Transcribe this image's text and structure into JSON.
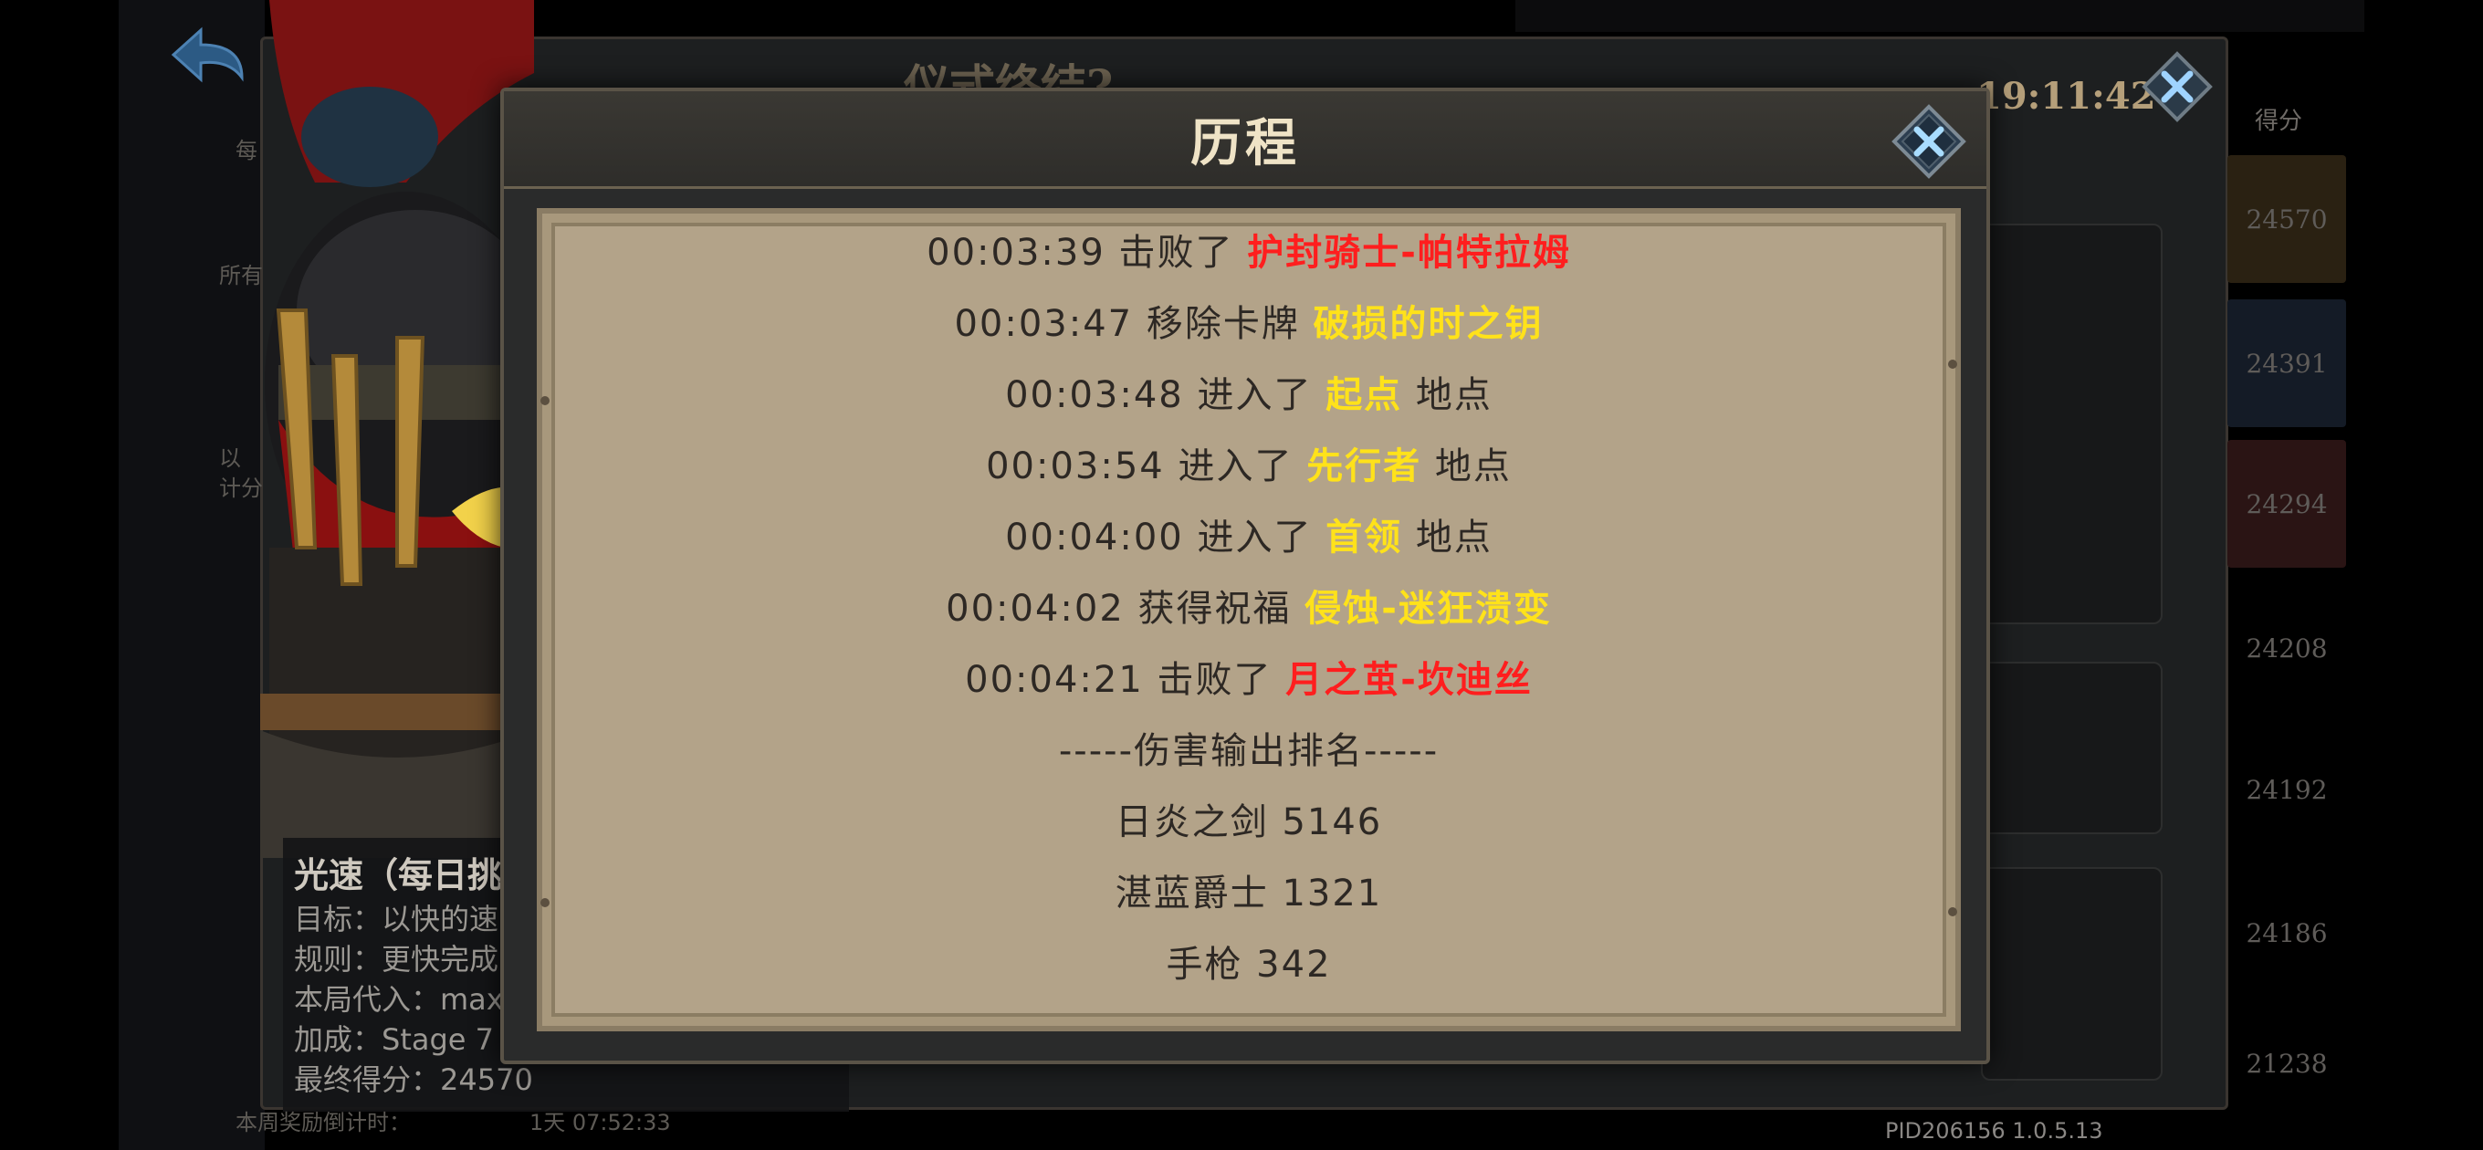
{
  "background": {
    "header_title": "仪式终结?",
    "timer": "19:11:42",
    "score_header": "得分",
    "scores": [
      "24570",
      "24391",
      "24294",
      "24208",
      "24192",
      "24186",
      "21238"
    ],
    "side_labels": [
      "每",
      "所有",
      "以",
      "计分"
    ],
    "info": {
      "title": "光速（每日挑",
      "target": "目标：以快的速",
      "rule": "规则：更快完成",
      "import": "本局代入：max",
      "bonus": "加成：Stage 7",
      "final_score": "最终得分：24570"
    },
    "countdown_label": "本周奖励倒计时：",
    "countdown_value": "1天 07:52:33",
    "pid": "PID206156  1.0.5.13"
  },
  "modal": {
    "title": "历程",
    "log": [
      {
        "time": "00:03:39",
        "action": "击败了",
        "target": "护封骑士-帕特拉姆",
        "color": "red",
        "suffix": ""
      },
      {
        "time": "00:03:47",
        "action": "移除卡牌",
        "target": "破损的时之钥",
        "color": "yellow",
        "suffix": ""
      },
      {
        "time": "00:03:48",
        "action": "进入了",
        "target": "起点",
        "color": "yellow",
        "suffix": "地点"
      },
      {
        "time": "00:03:54",
        "action": "进入了",
        "target": "先行者",
        "color": "yellow",
        "suffix": "地点"
      },
      {
        "time": "00:04:00",
        "action": "进入了",
        "target": "首领",
        "color": "yellow",
        "suffix": "地点"
      },
      {
        "time": "00:04:02",
        "action": "获得祝福",
        "target": "侵蚀-迷狂溃变",
        "color": "yellow",
        "suffix": ""
      },
      {
        "time": "00:04:21",
        "action": "击败了",
        "target": "月之茧-坎迪丝",
        "color": "red",
        "suffix": ""
      }
    ],
    "damage_header": "-----伤害输出排名-----",
    "damage_ranking": [
      {
        "name": "日炎之剑",
        "value": "5146"
      },
      {
        "name": "湛蓝爵士",
        "value": "1321"
      },
      {
        "name": "手枪",
        "value": "342"
      }
    ]
  },
  "colors": {
    "red": "#ff1e1e",
    "yellow": "#ffe21a",
    "parchment": "#b3a389"
  }
}
